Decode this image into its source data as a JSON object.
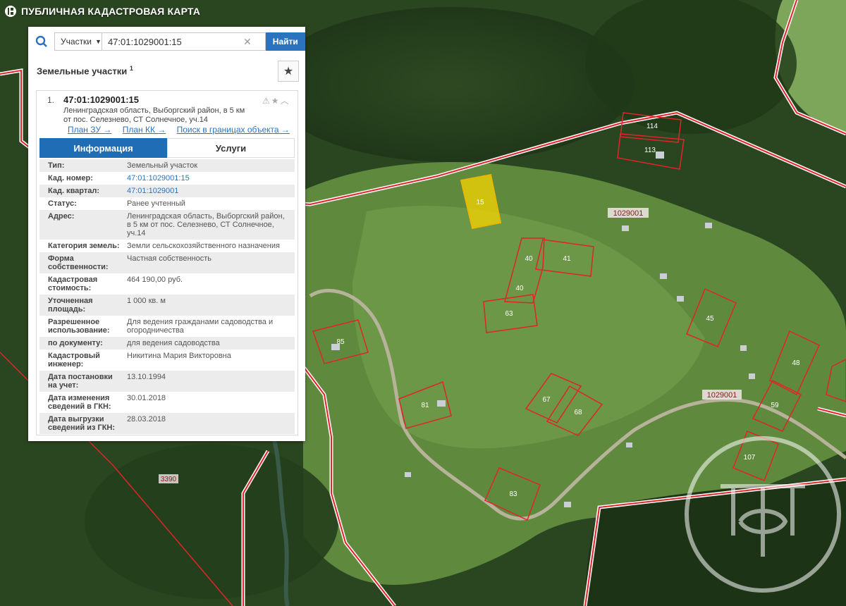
{
  "app": {
    "title": "ПУБЛИЧНАЯ КАДАСТРОВАЯ КАРТА"
  },
  "search": {
    "type_label": "Участки",
    "value": "47:01:1029001:15",
    "button": "Найти"
  },
  "results": {
    "title": "Земельные участки",
    "count": "1"
  },
  "item": {
    "index": "1.",
    "number": "47:01:1029001:15",
    "address_line1": "Ленинградская область, Выборгский район, в 5 км",
    "address_line2": "от пос. Селезнево, СТ Солнечное, уч.14",
    "links": [
      "План ЗУ →",
      "План КК →",
      "Поиск в границах объекта →"
    ]
  },
  "tabs": {
    "info": "Информация",
    "services": "Услуги"
  },
  "properties": [
    {
      "key": "Тип:",
      "value": "Земельный участок"
    },
    {
      "key": "Кад. номер:",
      "value": "47:01:1029001:15",
      "link": true
    },
    {
      "key": "Кад. квартал:",
      "value": "47:01:1029001",
      "link": true
    },
    {
      "key": "Статус:",
      "value": "Ранее учтенный"
    },
    {
      "key": "Адрес:",
      "value": "Ленинградская область, Выборгский район, в 5 км от пос. Селезнево, СТ Солнечное, уч.14"
    },
    {
      "key": "Категория земель:",
      "value": "Земли сельскохозяйственного назначения"
    },
    {
      "key": "Форма собственности:",
      "value": "Частная собственность"
    },
    {
      "key": "Кадастровая стоимость:",
      "value": "464 190,00 руб."
    },
    {
      "key": "Уточненная площадь:",
      "value": "1 000 кв. м"
    },
    {
      "key": "Разрешенное использование:",
      "value": "Для ведения гражданами садоводства и огородничества"
    },
    {
      "key": "по документу:",
      "value": "для ведения садоводства"
    },
    {
      "key": "Кадастровый инженер:",
      "value": "Никитина Мария Викторовна"
    },
    {
      "key": "Дата постановки на учет:",
      "value": "13.10.1994"
    },
    {
      "key": "Дата изменения сведений в ГКН:",
      "value": "30.01.2018"
    },
    {
      "key": "Дата выгрузки сведений из ГКН:",
      "value": "28.03.2018"
    }
  ],
  "map": {
    "quarter_labels": [
      "1029001",
      "1029001",
      "3390"
    ],
    "parcels": [
      "15",
      "40",
      "41",
      "40",
      "63",
      "45",
      "85",
      "48",
      "67",
      "68",
      "59",
      "81",
      "107",
      "83",
      "114",
      "113"
    ]
  },
  "colors": {
    "accent": "#2b74bd",
    "boundary": "#e0242a",
    "selected": "#f5d400"
  }
}
